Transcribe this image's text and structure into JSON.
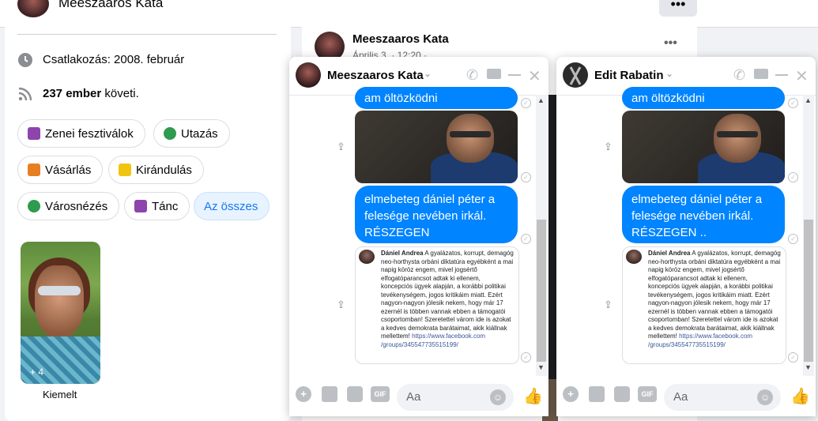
{
  "topbar": {
    "name": "Meeszaaros Kata",
    "more_icon": "•••"
  },
  "intro": {
    "joined": "Csatlakozás: 2008. február",
    "followers_count": "237 ember",
    "followers_suffix": " követi."
  },
  "interests": [
    {
      "label": "Zenei fesztiválok",
      "color": "#8e44ad"
    },
    {
      "label": "Utazás",
      "color": "#2e9b4f"
    },
    {
      "label": "Vásárlás",
      "color": "#e67e22"
    },
    {
      "label": "Kirándulás",
      "color": "#f1c40f"
    },
    {
      "label": "Városnézés",
      "color": "#2e9b4f"
    },
    {
      "label": "Tánc",
      "color": "#8e44ad"
    }
  ],
  "see_all": "Az összes",
  "featured": {
    "count": "+ 4",
    "label": "Kiemelt"
  },
  "post": {
    "author": "Meeszaaros Kata",
    "date": "Április 3. · 12:20 ·"
  },
  "chats": [
    {
      "name": "Meeszaaros Kata",
      "top_text": "am öltözködni",
      "message": "elmebeteg dániel péter a felesége nevében irkál. RÉSZEGEN",
      "card": {
        "author": "Dániel Andrea",
        "text": " A gyalázatos, korrupt, demagóg neo-horthysta orbáni diktatúra egyébként a mai napig köröz engem, mivel jogsértő elfogatóparancsot adtak ki ellenem, koncepciós ügyek alapján, a korábbi politikai tevékenységem, jogos kritikáim miatt. Ezért nagyon-nagyon jólesik nekem, hogy már 17 ezernél is többen vannak ebben a támogatói csoportomban! Szeretettel várom ide is azokat a kedves demokrata barátaimat, akik kiállnak mellettem! ",
        "link": "https://www.facebook.com /groups/345547735515199/"
      },
      "input_placeholder": "Aa",
      "gif_label": "GIF"
    },
    {
      "name": "Edit Rabatin",
      "top_text": "am öltözködni",
      "message": "elmebeteg dániel péter a felesége nevében irkál. RÉSZEGEN ..",
      "card": {
        "author": "Dániel Andrea",
        "text": " A gyalázatos, korrupt, demagóg neo-horthysta orbáni diktatúra egyébként a mai napig köröz engem, mivel jogsértő elfogatóparancsot adtak ki ellenem, koncepciós ügyek alapján, a korábbi politikai tevékenységem, jogos kritikáim miatt. Ezért nagyon-nagyon jólesik nekem, hogy már 17 ezernél is többen vannak ebben a támogatói csoportomban! Szeretettel várom ide is azokat a kedves demokrata barátaimat, akik kiállnak mellettem! ",
        "link": "https://www.facebook.com /groups/345547735515199/"
      },
      "input_placeholder": "Aa",
      "gif_label": "GIF"
    }
  ],
  "colors": {
    "accent": "#1877f2",
    "bubble": "#0084ff"
  }
}
